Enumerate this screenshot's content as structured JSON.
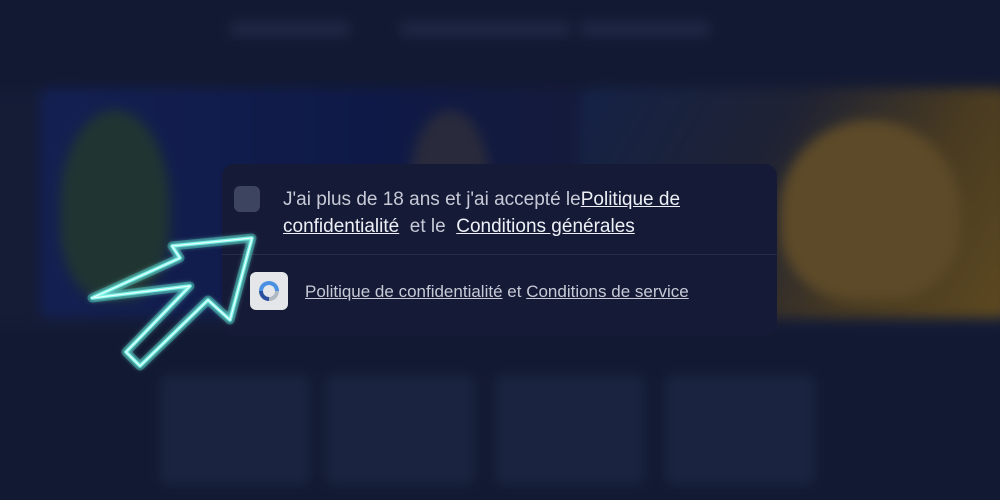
{
  "consent": {
    "text_prefix": "J'ai plus de 18 ans et j'ai accepté le",
    "privacy_link": "Politique de confidentialité",
    "connector": "et le",
    "terms_link": "Conditions générales"
  },
  "captcha": {
    "privacy_link": "Politique de confidentialité",
    "connector": "et",
    "terms_link": "Conditions de service"
  },
  "colors": {
    "card_bg": "#151a36",
    "arrow_glow": "#7ff6ec"
  },
  "icons": {
    "captcha": "recaptcha-icon",
    "pointer": "arrow-pointer-icon"
  }
}
